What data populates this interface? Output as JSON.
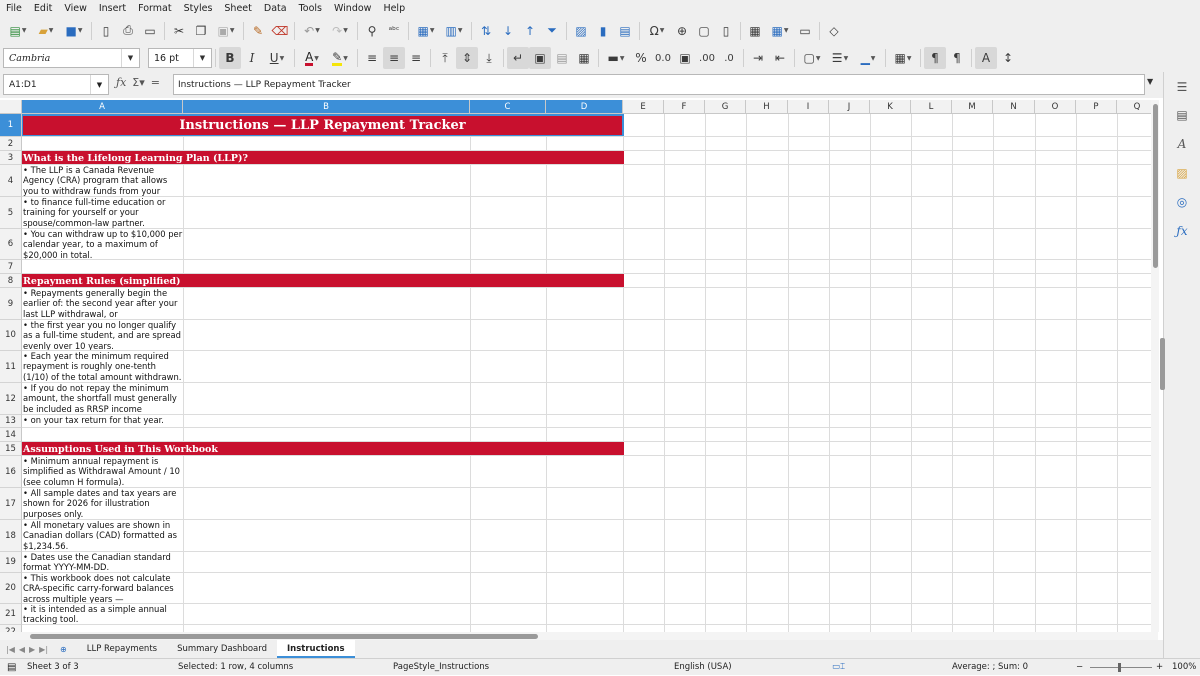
{
  "menu": [
    "File",
    "Edit",
    "View",
    "Insert",
    "Format",
    "Styles",
    "Sheet",
    "Data",
    "Tools",
    "Window",
    "Help"
  ],
  "toolbar": {
    "font_name": "Cambria",
    "font_size": "16 pt",
    "bold": "B",
    "italic": "I",
    "underline": "U"
  },
  "formula_bar": {
    "name_box": "A1:D1",
    "content": "Instructions — LLP Repayment Tracker"
  },
  "columns": [
    "A",
    "B",
    "C",
    "D",
    "E",
    "F",
    "G",
    "H",
    "I",
    "J",
    "K",
    "L",
    "M",
    "N",
    "O",
    "P",
    "Q"
  ],
  "rows": [
    "1",
    "2",
    "3",
    "4",
    "5",
    "6",
    "7",
    "8",
    "9",
    "10",
    "11",
    "12",
    "13",
    "14",
    "15",
    "16",
    "17",
    "18",
    "19",
    "20",
    "21",
    "22"
  ],
  "sheet": {
    "title": "Instructions — LLP Repayment Tracker",
    "section1_header": "What is the Lifelong Learning Plan (LLP)?",
    "r4": "• The LLP is a Canada Revenue Agency (CRA) program that allows you to withdraw funds from your RRSPs",
    "r5": "• to finance full-time education or training for yourself or your spouse/common-law partner.",
    "r6": "• You can withdraw up to $10,000 per calendar year, to a maximum of $20,000 in total.",
    "section2_header": "Repayment Rules (simplified)",
    "r9": "• Repayments generally begin the earlier of: the second year after your last LLP withdrawal, or",
    "r10": "• the first year you no longer qualify as a full-time student, and are spread evenly over 10 years.",
    "r11": "• Each year the minimum required repayment is roughly one-tenth (1/10) of the total amount withdrawn.",
    "r12": "• If you do not repay the minimum amount, the shortfall must generally be included as RRSP income",
    "r13": "• on your tax return for that year.",
    "section3_header": "Assumptions Used in This Workbook",
    "r16": "• Minimum annual repayment is simplified as Withdrawal Amount / 10 (see column H formula).",
    "r17": "• All sample dates and tax years are shown for 2026 for illustration purposes only.",
    "r18": "• All monetary values are shown in Canadian dollars (CAD) formatted as $1,234.56.",
    "r19": "• Dates use the Canadian standard format YYYY-MM-DD.",
    "r20": "• This workbook does not calculate CRA-specific carry-forward balances across multiple years —",
    "r21": "• it is intended as a simple annual tracking tool."
  },
  "tabs": [
    "LLP Repayments",
    "Summary Dashboard",
    "Instructions"
  ],
  "status": {
    "sheet": "Sheet 3 of 3",
    "selected": "Selected: 1 row, 4 columns",
    "page_style": "PageStyle_Instructions",
    "language": "English (USA)",
    "sum": "Average: ; Sum: 0",
    "zoom": "100%"
  },
  "colors": {
    "accent_red": "#c8102e",
    "selection_blue": "#3c8fd8"
  }
}
